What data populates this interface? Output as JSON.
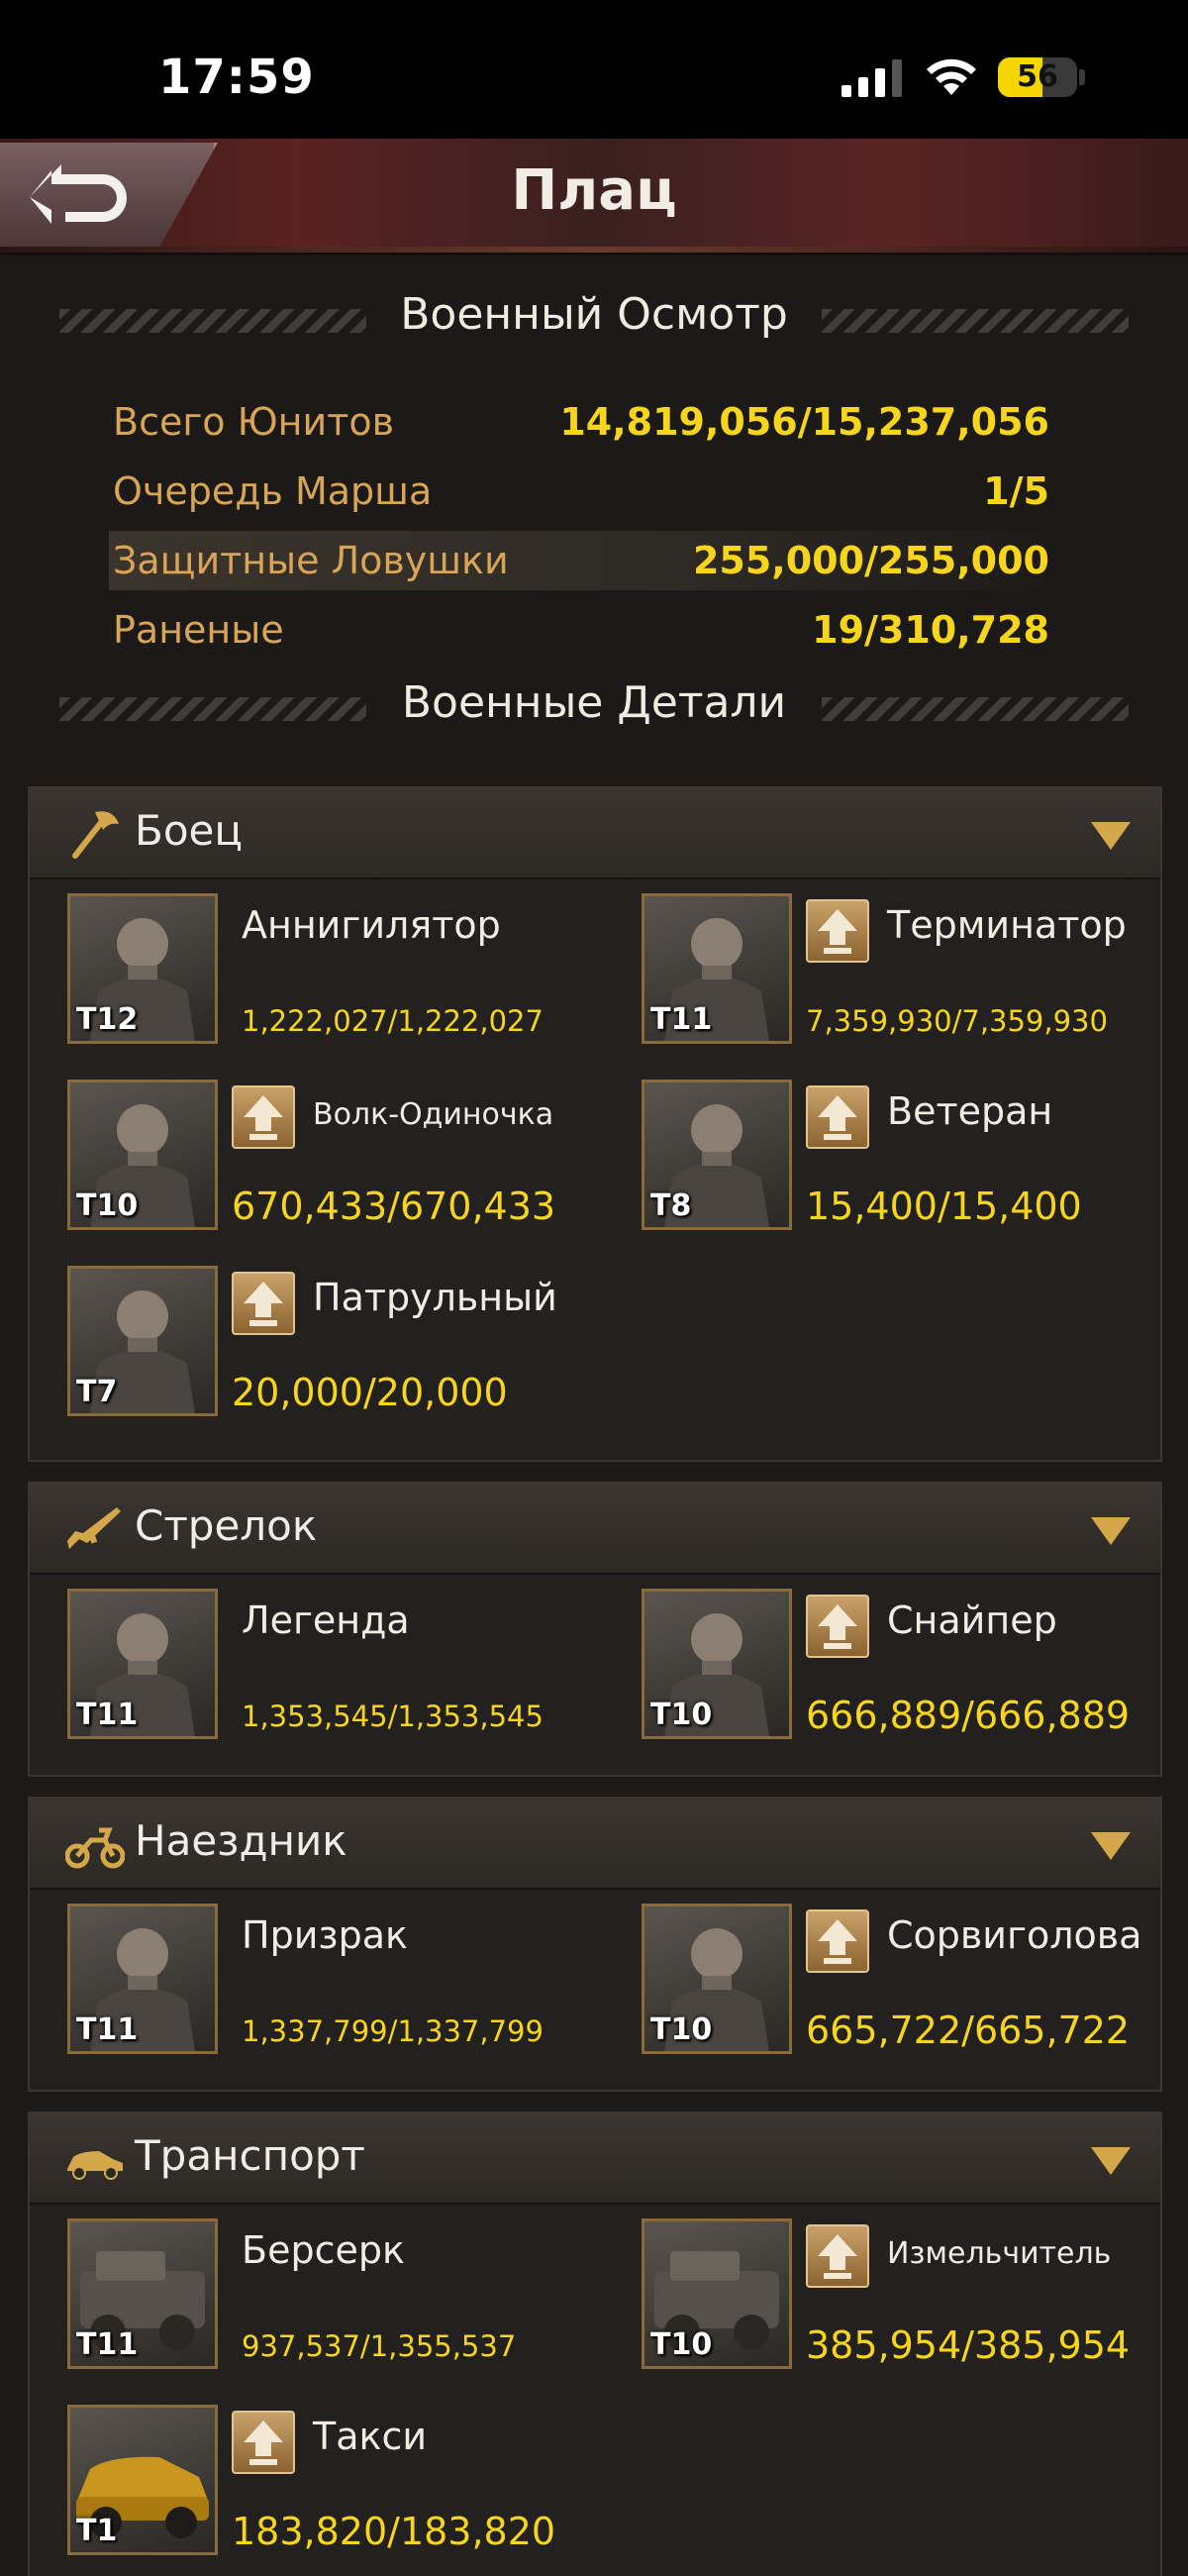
{
  "status_bar": {
    "time": "17:59",
    "battery": "56"
  },
  "header": {
    "title": "Плац"
  },
  "overview": {
    "title": "Военный Осмотр",
    "rows": [
      {
        "label": "Всего Юнитов",
        "value": "14,819,056/15,237,056"
      },
      {
        "label": "Очередь Марша",
        "value": "1/5"
      },
      {
        "label": "Защитные Ловушки",
        "value": "255,000/255,000"
      },
      {
        "label": "Раненые",
        "value": "19/310,728"
      }
    ]
  },
  "details": {
    "title": "Военные Детали"
  },
  "categories": [
    {
      "name": "Боец",
      "icon": "axe-icon",
      "units": [
        {
          "name": "Аннигилятор",
          "count": "1,222,027/1,222,027",
          "tier": "T12"
        },
        {
          "name": "Терминатор",
          "count": "7,359,930/7,359,930",
          "tier": "T11"
        },
        {
          "name": "Волк-Одиночка",
          "count": "670,433/670,433",
          "tier": "T10"
        },
        {
          "name": "Ветеран",
          "count": "15,400/15,400",
          "tier": "T8"
        },
        {
          "name": "Патрульный",
          "count": "20,000/20,000",
          "tier": "T7"
        }
      ]
    },
    {
      "name": "Стрелок",
      "icon": "rifle-icon",
      "units": [
        {
          "name": "Легенда",
          "count": "1,353,545/1,353,545",
          "tier": "T11"
        },
        {
          "name": "Снайпер",
          "count": "666,889/666,889",
          "tier": "T10"
        }
      ]
    },
    {
      "name": "Наездник",
      "icon": "motorcycle-icon",
      "units": [
        {
          "name": "Призрак",
          "count": "1,337,799/1,337,799",
          "tier": "T11"
        },
        {
          "name": "Сорвиголова",
          "count": "665,722/665,722",
          "tier": "T10"
        }
      ]
    },
    {
      "name": "Транспорт",
      "icon": "car-icon",
      "units": [
        {
          "name": "Берсерк",
          "count": "937,537/1,355,537",
          "tier": "T11"
        },
        {
          "name": "Измельчитель",
          "count": "385,954/385,954",
          "tier": "T10"
        },
        {
          "name": "Такси",
          "count": "183,820/183,820",
          "tier": "T1"
        }
      ]
    }
  ],
  "colors": {
    "label_gold": "#d8a457",
    "value_yellow": "#f7d51c",
    "frame_bronze": "#8a6a3a"
  }
}
